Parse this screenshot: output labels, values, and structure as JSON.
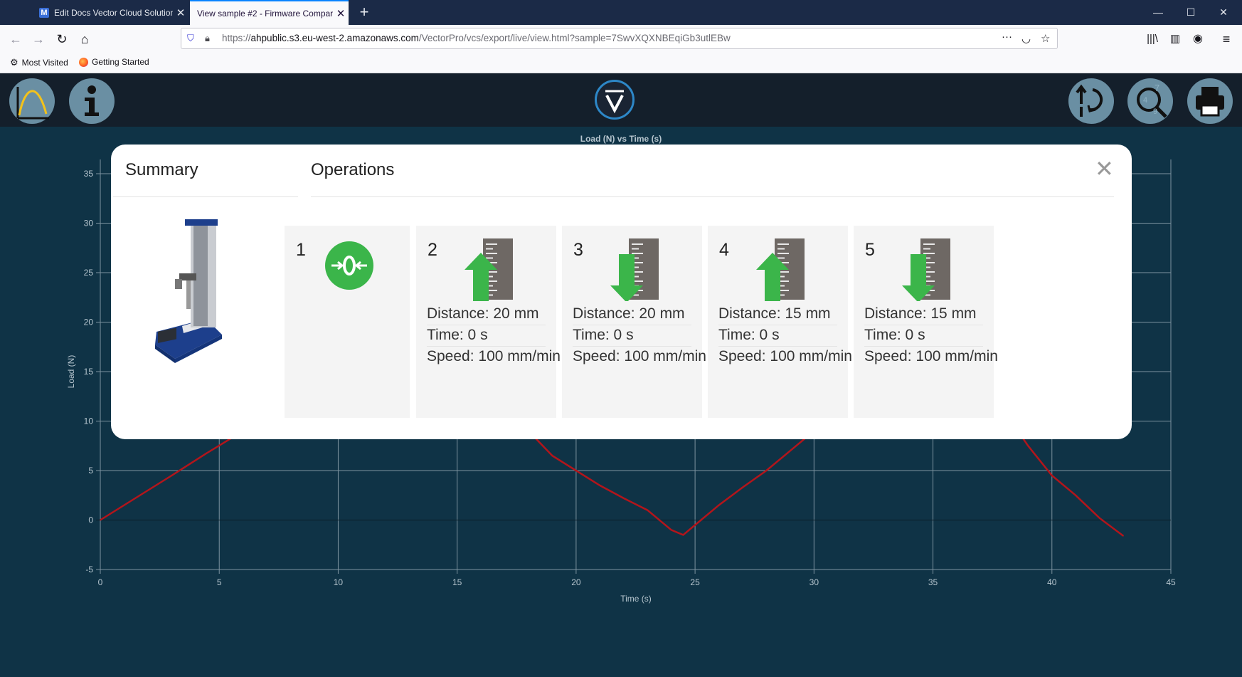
{
  "browser": {
    "tabs": [
      {
        "title": "Edit Docs Vector Cloud Solution",
        "active": false
      },
      {
        "title": "View sample #2 - Firmware Compar",
        "active": true
      }
    ],
    "url_prefix": "https://",
    "url_host": "ahpublic.s3.eu-west-2.amazonaws.com",
    "url_path": "/VectorPro/vcs/export/live/view.html?sample=7SwvXQXNBEqiGb3utlEBw",
    "bookmarks": [
      "Most Visited",
      "Getting Started"
    ]
  },
  "app": {
    "header_buttons_left": [
      "graph-icon",
      "info-icon"
    ],
    "header_buttons_right": [
      "compare-icon",
      "magnifier-icon",
      "printer-icon"
    ],
    "accent": "#2d87c7"
  },
  "chart_data": {
    "type": "line",
    "title": "Load (N) vs Time (s)",
    "xlabel": "Time (s)",
    "ylabel": "Load (N)",
    "xlim": [
      0,
      45
    ],
    "ylim": [
      -5,
      35
    ],
    "x_ticks": [
      0,
      5,
      10,
      15,
      20,
      25,
      30,
      35,
      40,
      45
    ],
    "y_ticks": [
      -5,
      0,
      5,
      10,
      15,
      20,
      25,
      30,
      35
    ],
    "grid": true,
    "series": [
      {
        "color": "#b3151b",
        "points": [
          [
            0,
            0
          ],
          [
            3,
            4.5
          ],
          [
            4.5,
            6.8
          ],
          [
            6,
            9
          ],
          [
            7,
            10.5
          ],
          [
            12,
            20
          ],
          [
            17,
            12
          ],
          [
            18,
            9
          ],
          [
            19,
            6.5
          ],
          [
            21,
            3.5
          ],
          [
            22,
            2.2
          ],
          [
            23,
            1
          ],
          [
            24,
            -1
          ],
          [
            24.5,
            -1.5
          ],
          [
            25,
            -0.5
          ],
          [
            26,
            1.5
          ],
          [
            27,
            3.3
          ],
          [
            28,
            5
          ],
          [
            29,
            7
          ],
          [
            30,
            9
          ],
          [
            31,
            10.5
          ],
          [
            36,
            18
          ],
          [
            38,
            11
          ],
          [
            39,
            7.5
          ],
          [
            40,
            4.5
          ],
          [
            41,
            2.5
          ],
          [
            42,
            0.2
          ],
          [
            43,
            -1.6
          ]
        ]
      }
    ]
  },
  "modal": {
    "summary_title": "Summary",
    "operations_title": "Operations",
    "close_label": "✕",
    "operations": [
      {
        "num": "1",
        "icon": "zero-load-icon",
        "lines": []
      },
      {
        "num": "2",
        "icon": "ruler-up-icon",
        "lines": [
          "Distance: 20 mm",
          "Time: 0 s",
          "Speed: 100 mm/min"
        ]
      },
      {
        "num": "3",
        "icon": "ruler-down-icon",
        "lines": [
          "Distance: 20 mm",
          "Time: 0 s",
          "Speed: 100 mm/min"
        ]
      },
      {
        "num": "4",
        "icon": "ruler-up-icon",
        "lines": [
          "Distance: 15 mm",
          "Time: 0 s",
          "Speed: 100 mm/min"
        ]
      },
      {
        "num": "5",
        "icon": "ruler-down-icon",
        "lines": [
          "Distance: 15 mm",
          "Time: 0 s",
          "Speed: 100 mm/min"
        ]
      }
    ]
  }
}
